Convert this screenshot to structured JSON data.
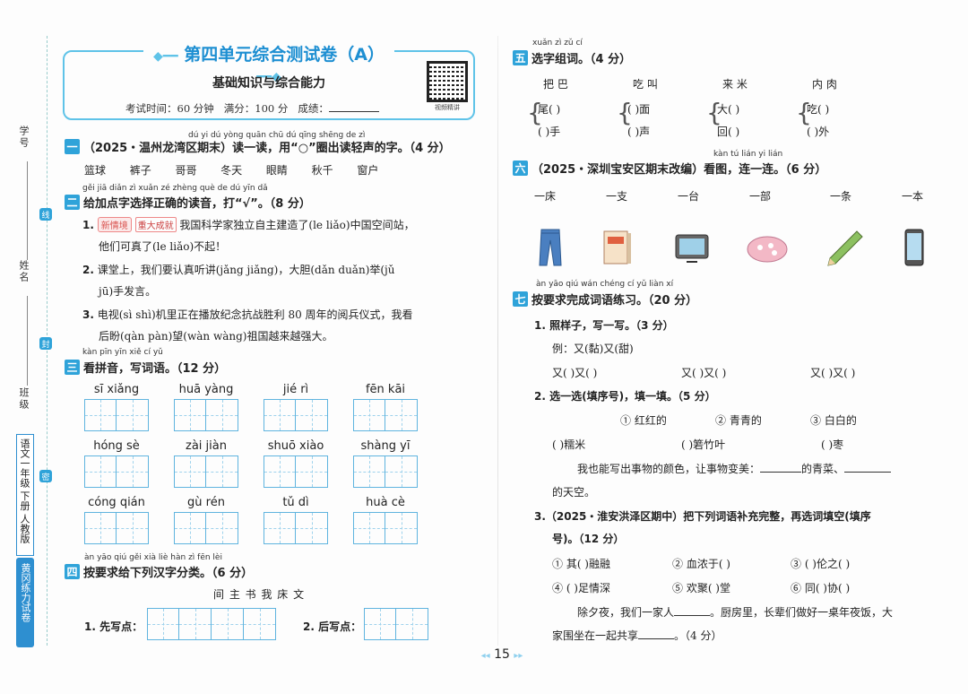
{
  "spine": {
    "xuehao": "学号",
    "xing": "姓名",
    "banji": "班级",
    "seal1": "线",
    "seal2": "封",
    "seal3": "密",
    "label_top": "语文一年级 下册 人教版",
    "label_bottom": "黄冈练力试卷"
  },
  "header": {
    "title": "第四单元综合测试卷（A）",
    "subtitle": "基础知识与综合能力",
    "exam_time": "考试时间：60 分钟",
    "full_score": "满分：100 分",
    "score_label": "成绩：",
    "qr_caption": "视频精讲"
  },
  "q1": {
    "num": "一",
    "pinyin": "dú yi dú    yòng      quān chū dú qīng shēng de zì",
    "title": "（2025・温州龙湾区期末）读一读，用“○”圈出读轻声的字。（4 分）",
    "words": [
      "篮球",
      "裤子",
      "哥哥",
      "冬天",
      "眼睛",
      "秋千",
      "窗户"
    ]
  },
  "q2": {
    "num": "二",
    "pinyin": "gěi jiā diǎn zì xuǎn zé zhèng què de dú yīn  dǎ",
    "title": "给加点字选择正确的读音，打“√”。（8 分）",
    "items": [
      {
        "no": "1.",
        "tag": "新情境",
        "tag2": "重大成就",
        "line1": "我国科学家独立自主建造了(le  liǎo)中国空间站，",
        "line2": "他们可真了(le  liǎo)不起！"
      },
      {
        "no": "2.",
        "line1": "课堂上，我们要认真听讲(jǎng  jiǎng)，大胆(dǎn  duǎn)举(jǔ",
        "line2": "jū)手发言。"
      },
      {
        "no": "3.",
        "line1": "电视(sì  shì)机里正在播放纪念抗战胜利 80 周年的阅兵仪式，我看",
        "line2": "后盼(qàn  pàn)望(wàn  wàng)祖国越来越强大。"
      }
    ]
  },
  "q3": {
    "num": "三",
    "pinyin": "kàn pīn yīn   xiě cí yǔ",
    "title": "看拼音，写词语。（12 分）",
    "items": [
      "sī  xiǎng",
      "huā  yàng",
      "jié  rì",
      "fēn  kāi",
      "hóng  sè",
      "zài  jiàn",
      "shuō  xiào",
      "shàng  yī",
      "cóng  qián",
      "gù  rén",
      "tǔ  dì",
      "huà  cè"
    ]
  },
  "q4": {
    "num": "四",
    "pinyin": "àn yāo qiú gěi xià liè hàn zì fēn lèi",
    "title": "按要求给下列汉字分类。（6 分）",
    "chars": "间   主   书   我   床   文",
    "part1": "1. 先写点：",
    "part2": "2. 后写点："
  },
  "q5": {
    "num": "五",
    "pinyin": "xuǎn zì zǔ cí",
    "title": "选字组词。（4 分）",
    "pairs": [
      "把   巴",
      "吃   叫",
      "来   米",
      "内   肉"
    ],
    "rows": [
      [
        "尾(    )",
        "(    )手"
      ],
      [
        "(    )面",
        "(    )声"
      ],
      [
        "大(    )",
        "回(    )"
      ],
      [
        "吃(    )",
        "(    )外"
      ]
    ]
  },
  "q6": {
    "num": "六",
    "pinyin": "kàn tú   lián yi lián",
    "title": "（2025・深圳宝安区期末改编）看图，连一连。（6 分）",
    "labels": [
      "一床",
      "一支",
      "一台",
      "一部",
      "一条",
      "一本"
    ]
  },
  "q7": {
    "num": "七",
    "pinyin": "àn yāo qiú wán chéng cí yǔ liàn xí",
    "title": "按要求完成词语练习。（20 分）",
    "p1": "1. 照样子，写一写。（3 分）",
    "p1_example": "例：又(黏)又(甜)",
    "p1_blanks": [
      "又(    )又(    )",
      "又(    )又(    )",
      "又(    )又(    )"
    ],
    "p2": "2. 选一选(填序号)，填一填。（5 分）",
    "p2_options": [
      "① 红红的",
      "② 青青的",
      "③ 白白的"
    ],
    "p2_fill": [
      "(    )糯米",
      "(    )箬竹叶",
      "(    )枣"
    ],
    "p2_sentence_a": "我也能写出事物的颜色，让事物变美：",
    "p2_sentence_b": "的青菜、",
    "p2_sentence_c": "的天空。",
    "p3_line1": "3.（2025・淮安洪泽区期中）把下列词语补充完整，再选词填空(填序",
    "p3_line2": "号)。（12 分）",
    "p3_row1": [
      "① 其(    )融融",
      "② 血浓于(    )",
      "③ (    )伦之(    )"
    ],
    "p3_row2": [
      "④ (    )足情深",
      "⑤ 欢聚(    )堂",
      "⑥ 同(    )协(    )"
    ],
    "p3_s1a": "除夕夜，我们一家人",
    "p3_s1b": "。厨房里，长辈们做好一桌年夜饭，大",
    "p3_s2a": "家围坐在一起共享",
    "p3_s2b": "。（4 分）"
  },
  "footer": {
    "page": "15"
  }
}
